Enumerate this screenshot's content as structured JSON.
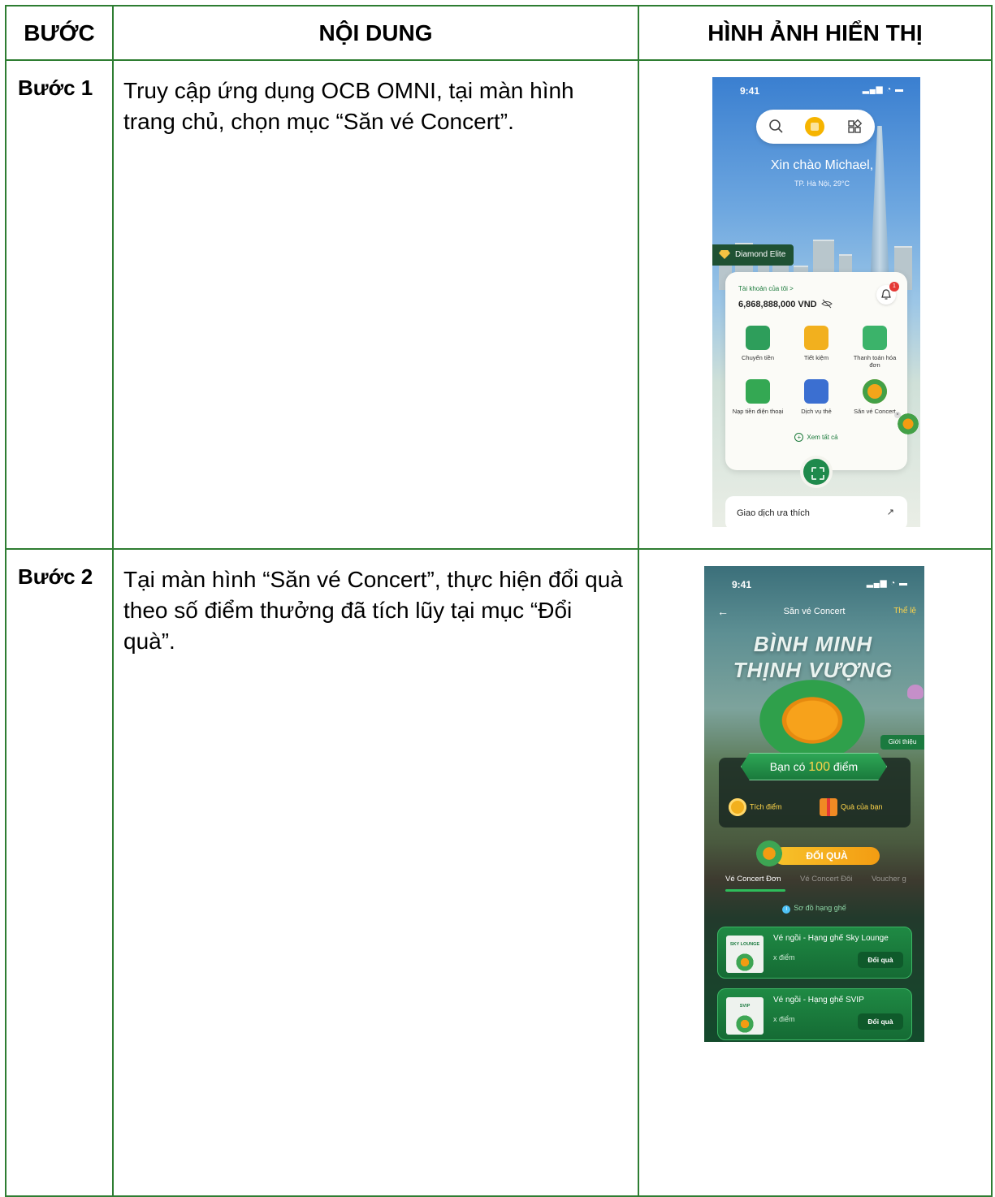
{
  "table": {
    "headers": {
      "step": "BƯỚC",
      "content": "NỘI DUNG",
      "image": "HÌNH ẢNH HIỂN THỊ"
    },
    "rows": [
      {
        "step": "Bước 1",
        "content": "Truy cập ứng dụng OCB OMNI, tại màn hình trang chủ, chọn mục “Săn vé Concert”."
      },
      {
        "step": "Bước 2",
        "content": "Tại màn hình “Săn vé Concert”, thực hiện đổi quà theo số điểm thưởng đã tích lũy tại mục “Đổi quà”."
      }
    ]
  },
  "screen1": {
    "time": "9:41",
    "greeting": "Xin chào Michael,",
    "location": "TP. Hà Nội, 29°C",
    "tier": "Diamond Elite",
    "account_link": "Tài khoản của tôi  >",
    "balance": "6,868,888,000 VND",
    "notification_count": "1",
    "services": [
      {
        "label": "Chuyển tiền",
        "color": "#2e9e5b"
      },
      {
        "label": "Tiết kiệm",
        "color": "#f2b01e"
      },
      {
        "label": "Thanh toán hóa đơn",
        "color": "#3bb36a"
      },
      {
        "label": "Nạp tiền điện thoại",
        "color": "#34a853"
      },
      {
        "label": "Dịch vụ thẻ",
        "color": "#3b6fd1"
      },
      {
        "label": "Săn vé Concert",
        "color": "#f3a51a"
      }
    ],
    "view_all": "Xem tất cả",
    "favorites": "Giao dịch ưa thích"
  },
  "screen2": {
    "time": "9:41",
    "title": "Săn vé Concert",
    "rules_link": "Thể lệ",
    "campaign_line1": "BÌNH MINH",
    "campaign_line2": "THỊNH VƯỢNG",
    "intro_tab": "Giới thiệu",
    "points_prefix": "Bạn có",
    "points_value": "100",
    "points_suffix": "điểm",
    "earn_points": "Tích điểm",
    "my_gifts": "Quà của bạn",
    "redeem_header": "ĐỔI QUÀ",
    "tabs": [
      "Vé Concert Đơn",
      "Vé Concert Đôi",
      "Voucher g"
    ],
    "seat_map": "Sơ đồ hạng ghế",
    "tickets": [
      {
        "tag": "SKY LOUNGE",
        "name": "Vé ngồi - Hạng ghế Sky Lounge",
        "points": "x điểm",
        "button": "Đổi quà"
      },
      {
        "tag": "SVIP",
        "name": "Vé ngồi - Hạng ghế SVIP",
        "points": "x điểm",
        "button": "Đổi quà"
      }
    ]
  }
}
